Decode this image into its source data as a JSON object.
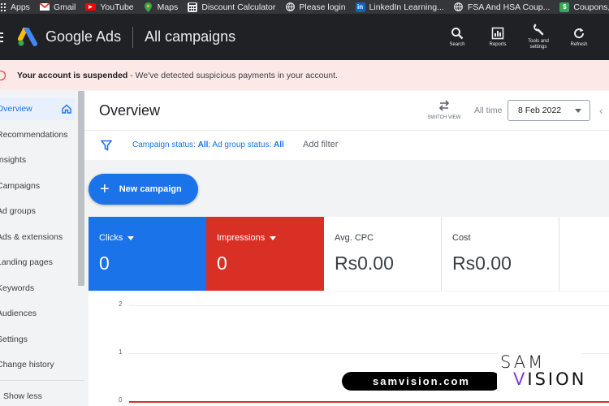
{
  "bookmarks": [
    {
      "label": "Apps",
      "icon": "apps-grid-icon",
      "color": "#e8eaed"
    },
    {
      "label": "Gmail",
      "icon": "gmail-icon",
      "color": "#ea4335"
    },
    {
      "label": "YouTube",
      "icon": "youtube-icon",
      "color": "#ff0000"
    },
    {
      "label": "Maps",
      "icon": "maps-icon",
      "color": "#34a853"
    },
    {
      "label": "Discount Calculator",
      "icon": "calculator-icon",
      "color": "#e8eaed"
    },
    {
      "label": "Please login",
      "icon": "globe-icon",
      "color": "#e8eaed"
    },
    {
      "label": "LinkedIn Learning...",
      "icon": "linkedin-icon",
      "color": "#0a66c2"
    },
    {
      "label": "FSA And HSA Coup...",
      "icon": "globe-icon",
      "color": "#e8eaed"
    },
    {
      "label": "Coupons, Coupon...",
      "icon": "coupon-icon",
      "color": "#34a853"
    }
  ],
  "header": {
    "brand": "Google Ads",
    "page": "All campaigns",
    "tools": [
      {
        "label": "Search",
        "icon": "search-icon"
      },
      {
        "label": "Reports",
        "icon": "reports-icon"
      },
      {
        "label": "Tools and settings",
        "icon": "wrench-icon"
      },
      {
        "label": "Refresh",
        "icon": "refresh-icon"
      }
    ]
  },
  "alert": {
    "bold": "Your account is suspended",
    "rest": " - We've detected suspicious payments in your account."
  },
  "sidebar": {
    "items": [
      {
        "label": "Overview",
        "active": true
      },
      {
        "label": "Recommendations"
      },
      {
        "label": "Insights"
      },
      {
        "label": "Campaigns"
      },
      {
        "label": "Ad groups"
      },
      {
        "label": "Ads & extensions"
      },
      {
        "label": "Landing pages"
      },
      {
        "label": "Keywords"
      },
      {
        "label": "Audiences"
      },
      {
        "label": "Settings"
      },
      {
        "label": "Change history"
      }
    ],
    "show_less": "Show less"
  },
  "overview": {
    "title": "Overview",
    "switch_view": "SWITCH VIEW",
    "all_time": "All time",
    "date": "8 Feb 2022"
  },
  "filter": {
    "campaign_status_label": "Campaign status: ",
    "campaign_status_value": "All",
    "ad_group_status_label": "; Ad group status: ",
    "ad_group_status_value": "All",
    "add_filter": "Add filter"
  },
  "new_campaign": "New campaign",
  "metrics": [
    {
      "label": "Clicks",
      "value": "0",
      "color": "#1a73e8"
    },
    {
      "label": "Impressions",
      "value": "0",
      "color": "#d93025"
    },
    {
      "label": "Avg. CPC",
      "value": "Rs0.00"
    },
    {
      "label": "Cost",
      "value": "Rs0.00"
    }
  ],
  "chart": {
    "yticks": [
      "2",
      "1",
      "0"
    ]
  },
  "watermark": {
    "url": "samvision.com",
    "logo_top": "SAM",
    "logo_bottom_v": "V",
    "logo_bottom_rest": "ISION"
  }
}
